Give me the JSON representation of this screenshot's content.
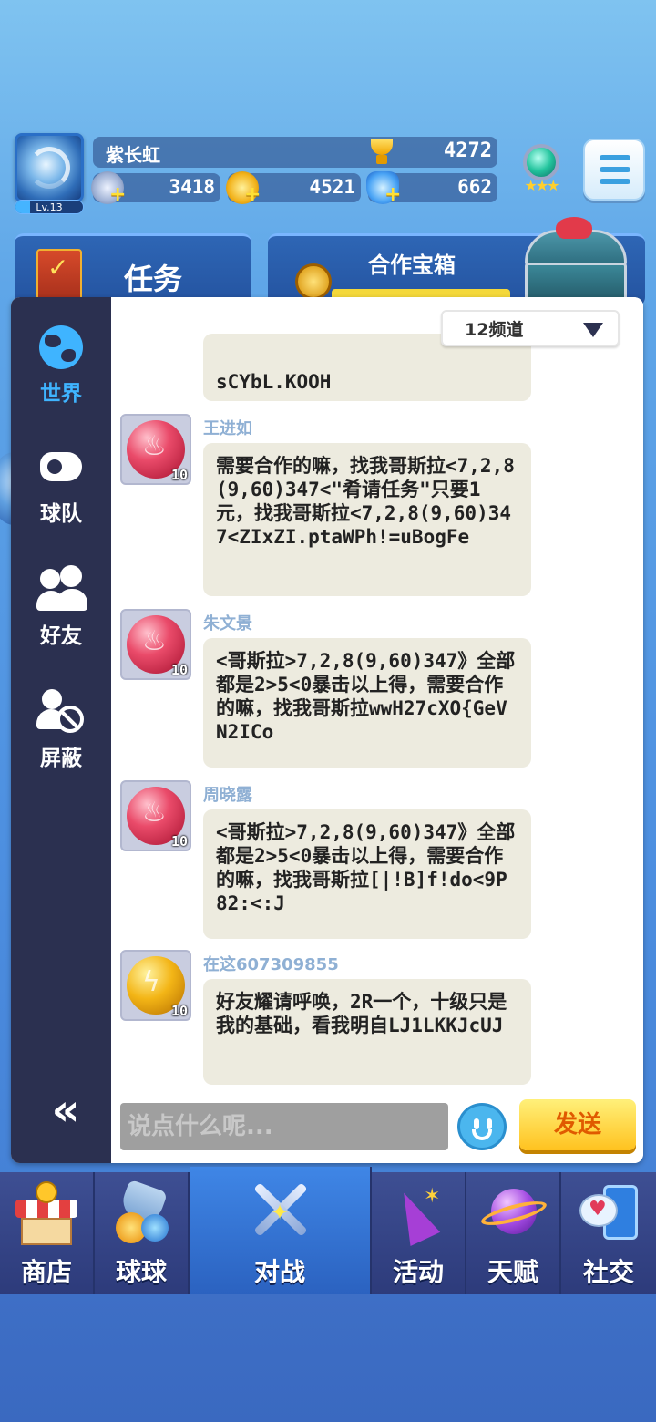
{
  "player": {
    "name": "紫长虹",
    "level": "Lv.13",
    "trophies": "4272",
    "silver": "3418",
    "gold": "4521",
    "gems": "662"
  },
  "panels": {
    "task_label": "任务",
    "coop_label": "合作宝箱"
  },
  "sidebar": {
    "items": [
      {
        "label": "世界",
        "icon": "globe-icon"
      },
      {
        "label": "球队",
        "icon": "whistle-icon"
      },
      {
        "label": "好友",
        "icon": "friends-icon"
      },
      {
        "label": "屏蔽",
        "icon": "block-icon"
      }
    ],
    "active": "世界"
  },
  "channel": {
    "selected": "12频道"
  },
  "messages": [
    {
      "sender": "",
      "text": "sCYbL.KOOH",
      "level": ""
    },
    {
      "sender": "王进如",
      "text": "需要合作的嘛，找我哥斯拉<7,2,8(9,60)347<\"肴请任务\"只要1元，找我哥斯拉<7,2,8(9,60)347<ZIxZI.ptaWPh!=uBogFe",
      "level": "10",
      "orb": "fire"
    },
    {
      "sender": "朱文景",
      "text": "<哥斯拉>7,2,8(9,60)347》全部都是2>5<0暴击以上得，需要合作的嘛，找我哥斯拉wwH27cXO{GeVN2ICo",
      "level": "10",
      "orb": "fire"
    },
    {
      "sender": "周晓露",
      "text": "<哥斯拉>7,2,8(9,60)347》全部都是2>5<0暴击以上得，需要合作的嘛，找我哥斯拉[|!B]f!do<9P82:<:J",
      "level": "10",
      "orb": "fire"
    },
    {
      "sender": "在这607309855",
      "text": "好友耀请呼唤，2R一个，十级只是我的基础，看我明自LJ1LKKJcUJ",
      "level": "10",
      "orb": "bolt"
    }
  ],
  "input": {
    "placeholder": "说点什么呢...",
    "send_label": "发送"
  },
  "bottom_nav": {
    "tabs": [
      {
        "label": "商店",
        "icon": "shop-icon"
      },
      {
        "label": "球球",
        "icon": "balls-icon"
      },
      {
        "label": "对战",
        "icon": "battle-icon"
      },
      {
        "label": "活动",
        "icon": "party-icon"
      },
      {
        "label": "天赋",
        "icon": "planet-icon"
      },
      {
        "label": "社交",
        "icon": "social-icon"
      }
    ],
    "active": "对战"
  },
  "colors": {
    "accent_blue": "#3fb4ff",
    "sidebar_bg": "#2b3050",
    "bubble_bg": "#edebdf",
    "send_button": "#ffc21f"
  }
}
